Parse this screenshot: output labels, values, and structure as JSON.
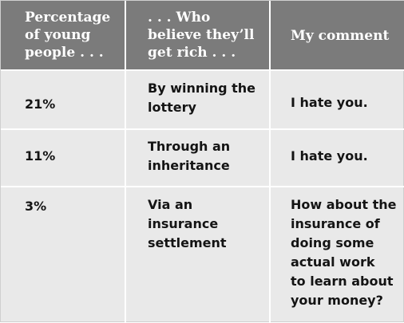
{
  "table": {
    "headers": [
      "Percentage\nof young\npeople . . .",
      ". . . Who\nbelieve they’ll\nget rich . . .",
      "My comment"
    ],
    "rows": [
      {
        "percentage": "21%",
        "method": "By winning the\nlottery",
        "comment": "I hate you."
      },
      {
        "percentage": "11%",
        "method": "Through an\ninheritance",
        "comment": "I hate you."
      },
      {
        "percentage": "3%",
        "method": "Via an\ninsurance\nsettlement",
        "comment": "How about the\ninsurance of\ndoing some\nactual work\nto learn about\nyour money?"
      }
    ]
  }
}
